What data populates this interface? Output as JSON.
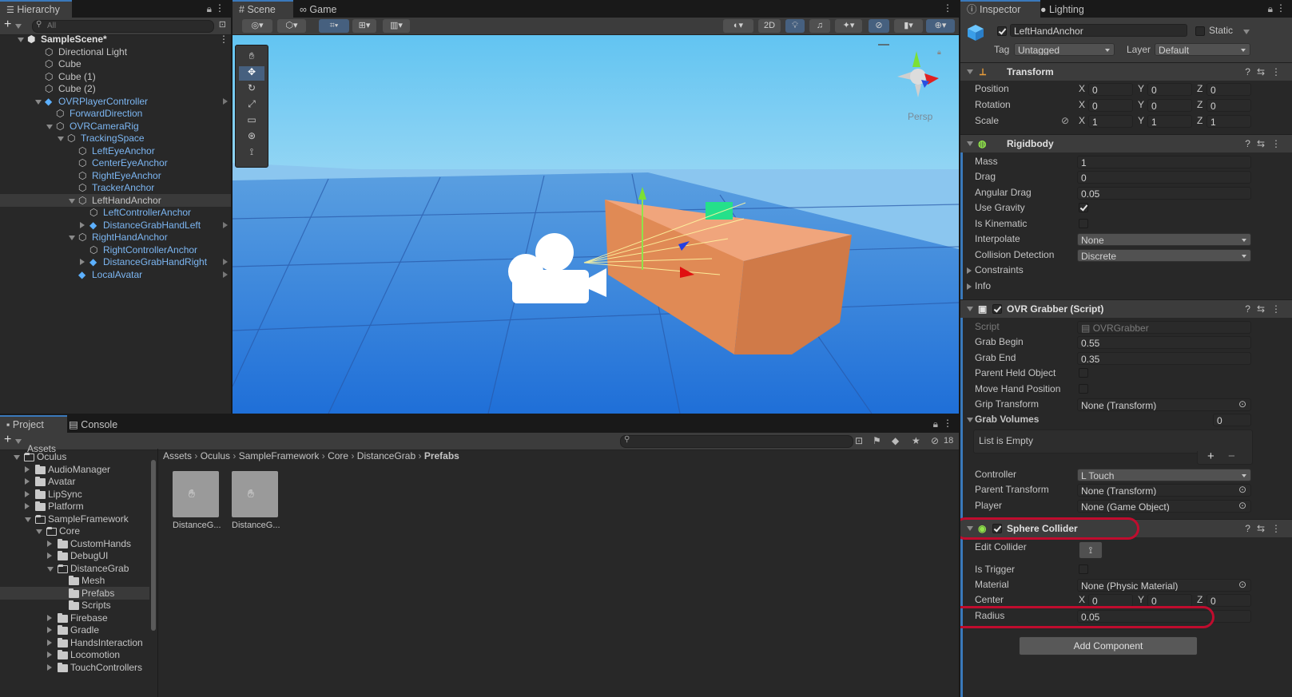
{
  "hierarchy": {
    "tab": "Hierarchy",
    "search_placeholder": "All",
    "items": [
      {
        "label": "SampleScene*"
      },
      {
        "label": "Directional Light"
      },
      {
        "label": "Cube"
      },
      {
        "label": "Cube (1)"
      },
      {
        "label": "Cube (2)"
      },
      {
        "label": "OVRPlayerController"
      },
      {
        "label": "ForwardDirection"
      },
      {
        "label": "OVRCameraRig"
      },
      {
        "label": "TrackingSpace"
      },
      {
        "label": "LeftEyeAnchor"
      },
      {
        "label": "CenterEyeAnchor"
      },
      {
        "label": "RightEyeAnchor"
      },
      {
        "label": "TrackerAnchor"
      },
      {
        "label": "LeftHandAnchor"
      },
      {
        "label": "LeftControllerAnchor"
      },
      {
        "label": "DistanceGrabHandLeft"
      },
      {
        "label": "RightHandAnchor"
      },
      {
        "label": "RightControllerAnchor"
      },
      {
        "label": "DistanceGrabHandRight"
      },
      {
        "label": "LocalAvatar"
      }
    ]
  },
  "scene": {
    "tabs": [
      "Scene",
      "Game"
    ],
    "btn_2d": "2D",
    "persp_label": "Persp"
  },
  "project": {
    "tabs": [
      "Project",
      "Console"
    ],
    "hidden_count": "18",
    "breadcrumb": [
      "Assets",
      "Oculus",
      "SampleFramework",
      "Core",
      "DistanceGrab",
      "Prefabs"
    ],
    "tree_top": "Assets",
    "tree": [
      {
        "label": "Oculus"
      },
      {
        "label": "AudioManager"
      },
      {
        "label": "Avatar"
      },
      {
        "label": "LipSync"
      },
      {
        "label": "Platform"
      },
      {
        "label": "SampleFramework"
      },
      {
        "label": "Core"
      },
      {
        "label": "CustomHands"
      },
      {
        "label": "DebugUI"
      },
      {
        "label": "DistanceGrab"
      },
      {
        "label": "Mesh"
      },
      {
        "label": "Prefabs"
      },
      {
        "label": "Scripts"
      },
      {
        "label": "Firebase"
      },
      {
        "label": "Gradle"
      },
      {
        "label": "HandsInteraction"
      },
      {
        "label": "Locomotion"
      },
      {
        "label": "TouchControllers"
      }
    ],
    "assets": [
      {
        "label": "DistanceG..."
      },
      {
        "label": "DistanceG..."
      }
    ]
  },
  "inspector": {
    "tabs": [
      "Inspector",
      "Lighting"
    ],
    "object_name": "LeftHandAnchor",
    "static_label": "Static",
    "tag_label": "Tag",
    "tag_value": "Untagged",
    "layer_label": "Layer",
    "layer_value": "Default",
    "transform": {
      "title": "Transform",
      "position_label": "Position",
      "position": [
        "0",
        "0",
        "0"
      ],
      "rotation_label": "Rotation",
      "rotation": [
        "0",
        "0",
        "0"
      ],
      "scale_label": "Scale",
      "scale": [
        "1",
        "1",
        "1"
      ]
    },
    "rigidbody": {
      "title": "Rigidbody",
      "mass_label": "Mass",
      "mass": "1",
      "drag_label": "Drag",
      "drag": "0",
      "angular_drag_label": "Angular Drag",
      "angular_drag": "0.05",
      "use_gravity_label": "Use Gravity",
      "is_kinematic_label": "Is Kinematic",
      "interpolate_label": "Interpolate",
      "interpolate": "None",
      "collision_label": "Collision Detection",
      "collision": "Discrete",
      "constraints_label": "Constraints",
      "info_label": "Info"
    },
    "grabber": {
      "title": "OVR Grabber (Script)",
      "script_label": "Script",
      "script_value": "OVRGrabber",
      "grab_begin_label": "Grab Begin",
      "grab_begin": "0.55",
      "grab_end_label": "Grab End",
      "grab_end": "0.35",
      "parent_held_label": "Parent Held Object",
      "move_hand_label": "Move Hand Position",
      "grip_transform_label": "Grip Transform",
      "grip_transform": "None (Transform)",
      "grab_volumes_label": "Grab Volumes",
      "grab_volumes_count": "0",
      "list_empty": "List is Empty",
      "controller_label": "Controller",
      "controller": "L Touch",
      "parent_transform_label": "Parent Transform",
      "parent_transform": "None (Transform)",
      "player_label": "Player",
      "player": "None (Game Object)"
    },
    "sphere": {
      "title": "Sphere Collider",
      "edit_collider_label": "Edit Collider",
      "is_trigger_label": "Is Trigger",
      "material_label": "Material",
      "material": "None (Physic Material)",
      "center_label": "Center",
      "center": [
        "0",
        "0",
        "0"
      ],
      "radius_label": "Radius",
      "radius": "0.05"
    },
    "add_component": "Add Component"
  },
  "colors": {
    "accent": "#3a79bb",
    "highlight": "#c00c2e",
    "sky": "#5fc2f0",
    "ground": "#3a82d8",
    "box": "#e08a55"
  }
}
